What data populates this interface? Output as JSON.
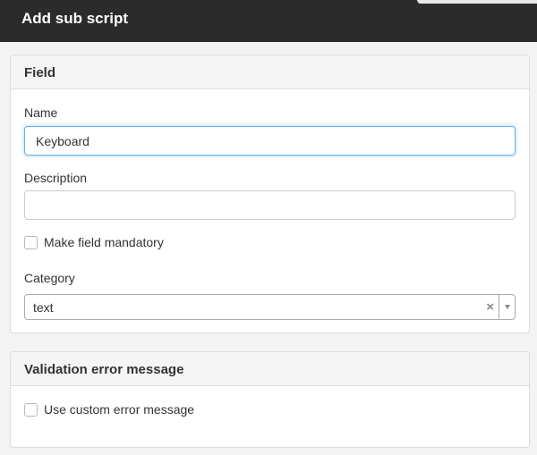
{
  "header": {
    "title": "Add sub script"
  },
  "field_panel": {
    "heading": "Field",
    "name_label": "Name",
    "name_value": "Keyboard",
    "description_label": "Description",
    "description_value": "",
    "mandatory_label": "Make field mandatory",
    "mandatory_checked": false,
    "category_label": "Category",
    "category_selected": "text",
    "category_clear_glyph": "×"
  },
  "validation_panel": {
    "heading": "Validation error message",
    "custom_label": "Use custom error message",
    "custom_checked": false
  },
  "colors": {
    "header_bg": "#2b2b2b",
    "focus_border": "#66afe9"
  },
  "icons": {
    "clear": "close-icon",
    "dropdown": "chevron-down-icon"
  }
}
